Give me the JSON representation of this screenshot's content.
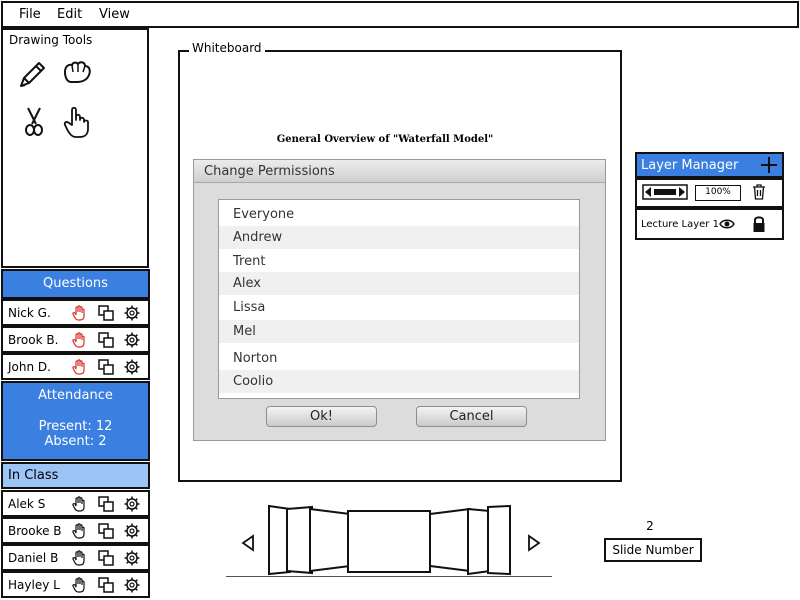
{
  "menu": [
    "File",
    "Edit",
    "View"
  ],
  "drawing_tools": {
    "title": "Drawing Tools",
    "tools": [
      "pencil-icon",
      "glove-icon",
      "scissors-icon",
      "hand-pointer-icon"
    ]
  },
  "questions": {
    "header": "Questions",
    "students": [
      "Nick G.",
      "Brook B.",
      "John D."
    ]
  },
  "attendance": {
    "header": "Attendance",
    "present": "Present: 12",
    "absent": "Absent: 2"
  },
  "in_class": {
    "header": "In Class",
    "students": [
      "Alek S",
      "Brooke B",
      "Daniel B",
      "Hayley L"
    ]
  },
  "whiteboard": {
    "label": "Whiteboard",
    "heading": "General Overview of \"Waterfall Model\""
  },
  "dialog": {
    "title": "Change Permissions",
    "items": [
      "Everyone",
      "Andrew",
      "Trent",
      "Alex",
      "Lissa",
      "Mel",
      "Norton",
      "Coolio"
    ],
    "ok_label": "Ok!",
    "cancel_label": "Cancel"
  },
  "layer_manager": {
    "title": "Layer Manager",
    "zoom": "100%",
    "layer_name": "Lecture Layer 1"
  },
  "slides": {
    "number": "2",
    "label": "Slide Number"
  },
  "colors": {
    "accent_blue": "#3b7fe0",
    "raised_hand_red": "#d9302a"
  }
}
